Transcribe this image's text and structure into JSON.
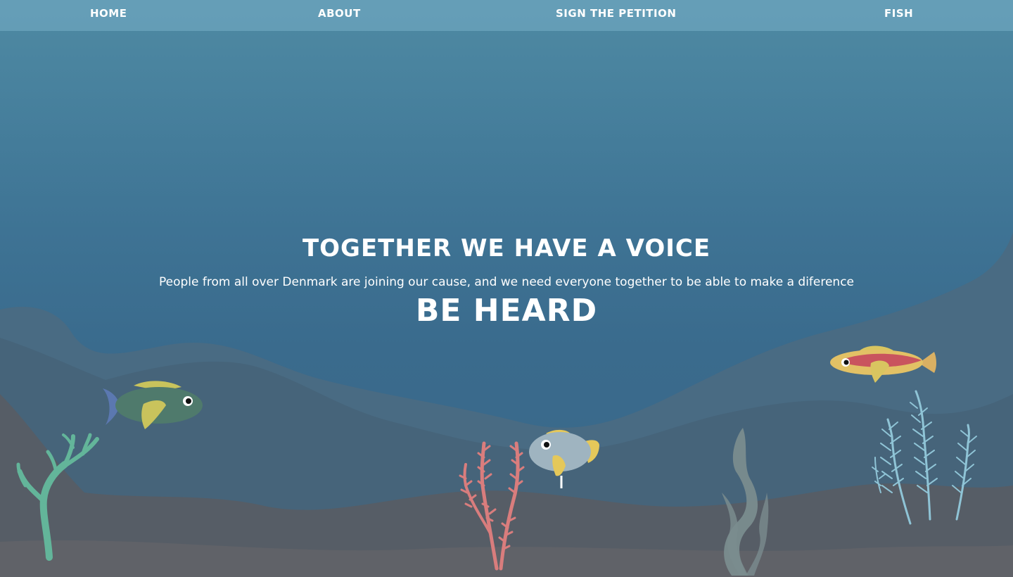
{
  "nav": {
    "home": "HOME",
    "about": "ABOUT",
    "petition": "SIGN THE PETITION",
    "fish": "FISH"
  },
  "hero": {
    "title": "TOGETHER WE HAVE A VOICE",
    "subtitle": "People from all over Denmark are joining our cause, and we need everyone together to be able to make a diference",
    "cta": "BE HEARD"
  },
  "colors": {
    "water_top": "#4f8aa3",
    "water_bottom": "#3b6888",
    "seabed": "#5f6369",
    "seaweed_green": "#63b59a",
    "coral_pink": "#d97d7d",
    "kelp_grey": "#7a8c8e",
    "fern_blue": "#8fc4d6"
  }
}
